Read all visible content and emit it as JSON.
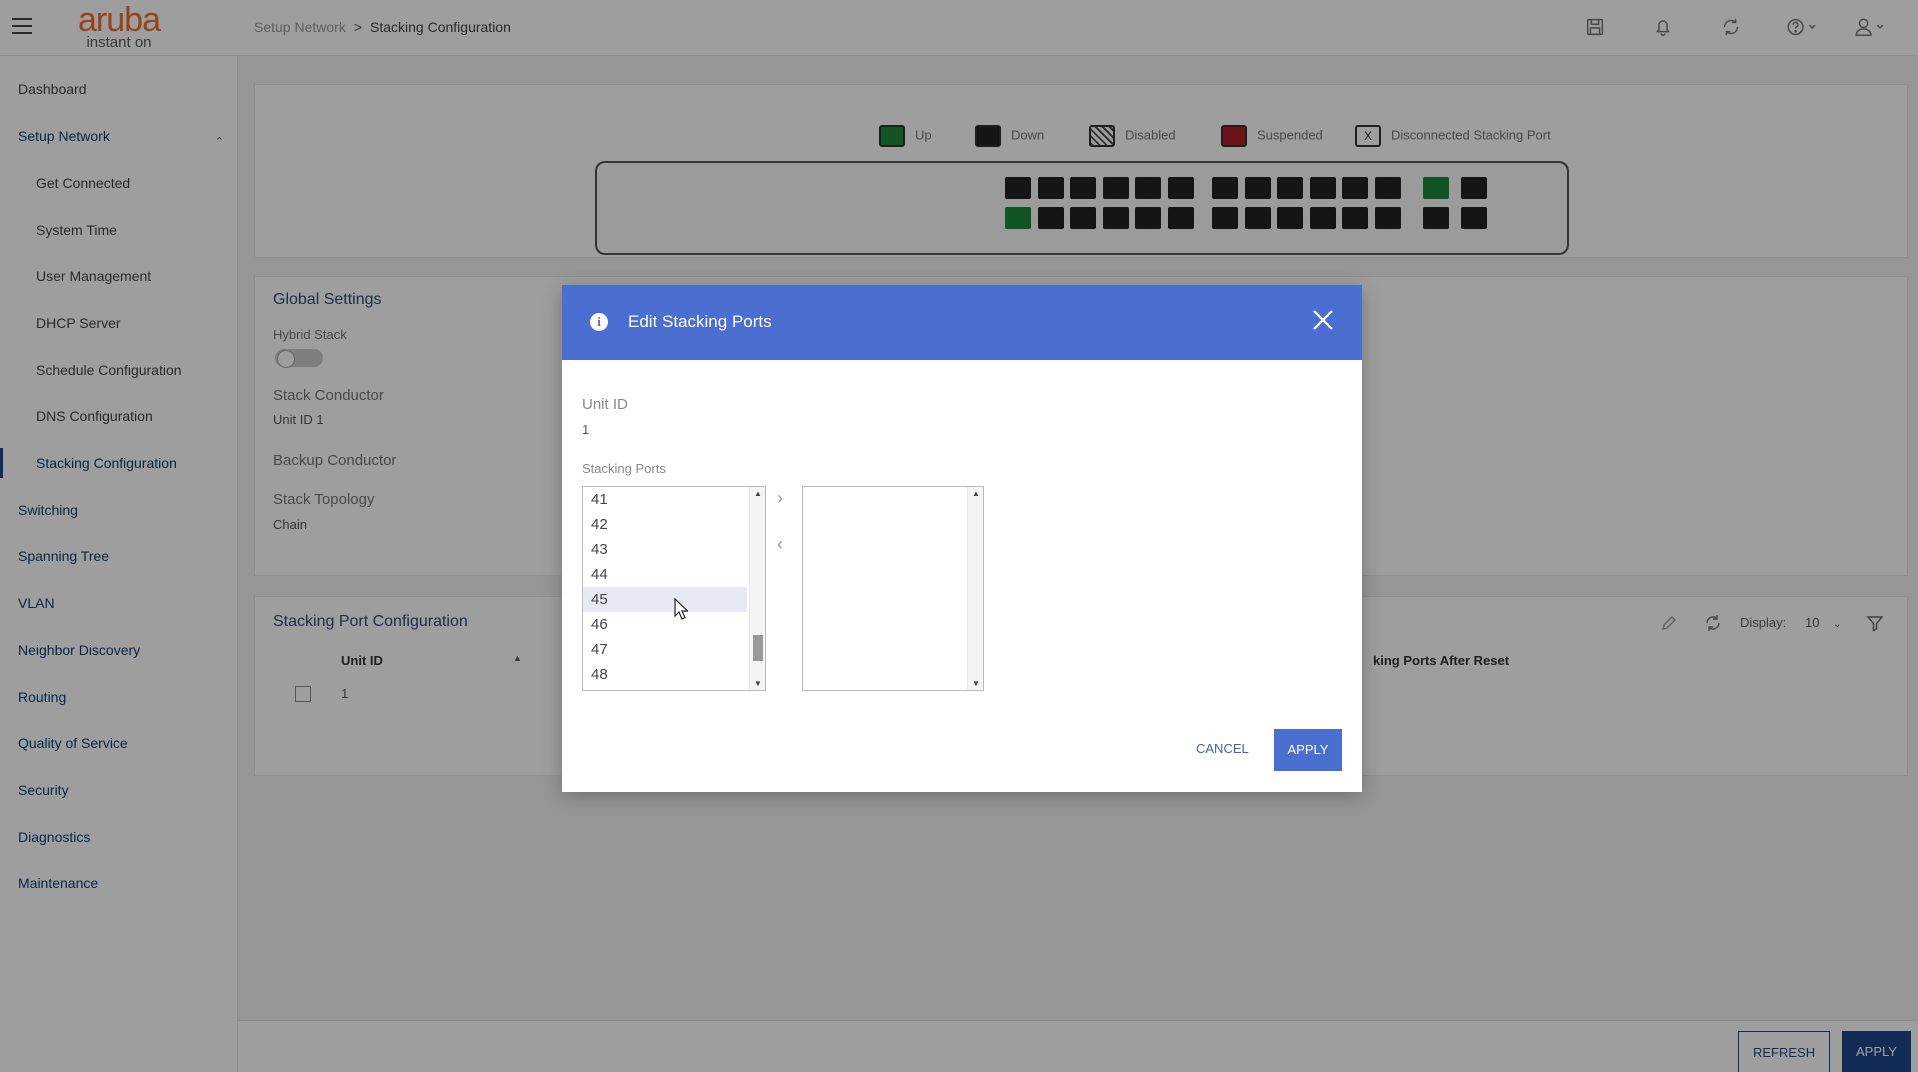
{
  "topbar": {
    "logo_text": "aruba",
    "logo_sub": "instant on",
    "breadcrumb": {
      "parent": "Setup Network",
      "separator": ">",
      "current": "Stacking Configuration"
    }
  },
  "sidebar": {
    "items": [
      {
        "label": "Dashboard"
      },
      {
        "label": "Setup Network"
      },
      {
        "label": "Get Connected"
      },
      {
        "label": "System Time"
      },
      {
        "label": "User Management"
      },
      {
        "label": "DHCP Server"
      },
      {
        "label": "Schedule Configuration"
      },
      {
        "label": "DNS Configuration"
      },
      {
        "label": "Stacking Configuration"
      },
      {
        "label": "Switching"
      },
      {
        "label": "Spanning Tree"
      },
      {
        "label": "VLAN"
      },
      {
        "label": "Neighbor Discovery"
      },
      {
        "label": "Routing"
      },
      {
        "label": "Quality of Service"
      },
      {
        "label": "Security"
      },
      {
        "label": "Diagnostics"
      },
      {
        "label": "Maintenance"
      }
    ]
  },
  "legend": {
    "items": [
      {
        "label": "Up",
        "color": "#1e8a3c"
      },
      {
        "label": "Down",
        "color": "#222222"
      },
      {
        "label": "Disabled",
        "color": "#555555"
      },
      {
        "label": "Suspended",
        "color": "#b3202a"
      },
      {
        "label": "Disconnected Stacking Port",
        "color": "#333333"
      }
    ]
  },
  "global_settings": {
    "title": "Global Settings",
    "hybrid_stack_label": "Hybrid Stack",
    "stack_conductor_label": "Stack Conductor",
    "stack_conductor_value": "Unit ID 1",
    "backup_conductor_label": "Backup Conductor",
    "stack_topology_label": "Stack Topology",
    "stack_topology_value": "Chain"
  },
  "stacking_port_config": {
    "title": "Stacking Port Configuration",
    "col_unit_id": "Unit ID",
    "col_after_reset": "king Ports After Reset",
    "display_label": "Display:",
    "display_value": "10",
    "row_unit_id": "1"
  },
  "bottombar": {
    "refresh": "REFRESH",
    "apply": "APPLY"
  },
  "modal": {
    "title": "Edit Stacking Ports",
    "unit_id_label": "Unit ID",
    "unit_id_value": "1",
    "stacking_ports_label": "Stacking Ports",
    "available_ports": [
      "41",
      "42",
      "43",
      "44",
      "45",
      "46",
      "47",
      "48"
    ],
    "selected_ports": [],
    "cancel": "CANCEL",
    "apply": "APPLY"
  }
}
